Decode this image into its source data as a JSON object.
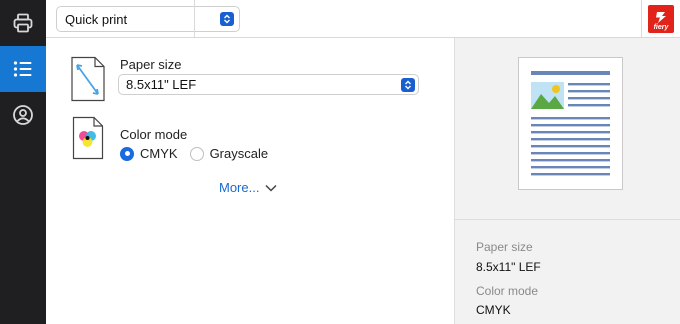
{
  "sidebar": {
    "items": [
      {
        "name": "printer",
        "active": false
      },
      {
        "name": "list",
        "active": true
      },
      {
        "name": "user",
        "active": false
      }
    ]
  },
  "header": {
    "preset": "Quick print",
    "logo_text": "fiery"
  },
  "form": {
    "paper_size_label": "Paper size",
    "paper_size_value": "8.5x11\" LEF",
    "color_mode_label": "Color mode",
    "color_options": [
      "CMYK",
      "Grayscale"
    ],
    "color_selected": "CMYK",
    "more_label": "More..."
  },
  "summary": {
    "paper_size_label": "Paper size",
    "paper_size_value": "8.5x11\" LEF",
    "color_mode_label": "Color mode",
    "color_mode_value": "CMYK"
  },
  "colors": {
    "accent": "#1778d3",
    "sidebar_bg": "#1f1f21",
    "link": "#1a6ad2",
    "brand_red": "#e2231a"
  }
}
